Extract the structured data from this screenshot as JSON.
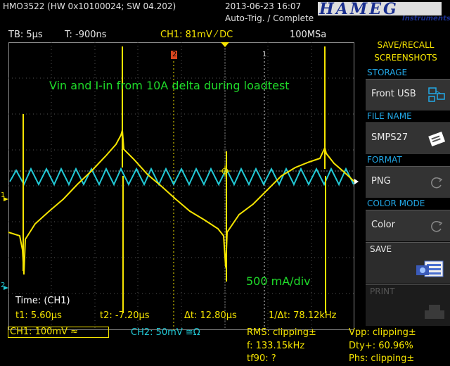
{
  "header": {
    "instrument": "HMO3522 (HW 0x10100024; SW 04.202)",
    "datetime": "2013-06-23 16:07",
    "trigger_status": "Auto-Trig. / Complete",
    "logo": "HAMEG",
    "logo_sub": "Instruments"
  },
  "status_bar": {
    "timebase": "TB: 5µs",
    "trigger_time": "T: -900ns",
    "ch1_trigger": "CH1: 81mV ⁄ DC",
    "sample_rate": "100MSa"
  },
  "screen": {
    "annotation": "Vin and I-in from 10A delta during loadtest",
    "scale_note": "500 mA/div",
    "marker_cursor_1": "1",
    "marker_cursor_2": "2",
    "ch1_marker": "1",
    "ch2_marker": "2"
  },
  "cursors": {
    "title": "Time: (CH1)",
    "t1": "t1: 5.60µs",
    "t2": "t2: -7.20µs",
    "dt": "Δt: 12.80µs",
    "inv_dt": "1/Δt: 78.12kHz"
  },
  "bottom": {
    "ch1": "CH1: 100mV ≈",
    "ch2": "CH2: 50mV ≅Ω",
    "rms": "RMS: clipping±",
    "freq": "f: 133.15kHz",
    "tf90": "tf90: ?",
    "vpp": "Vpp: clipping±",
    "duty": "Dty+: 60.96%",
    "phase": "Phs: clipping±"
  },
  "menu": {
    "title_line1": "SAVE/RECALL",
    "title_line2": "SCREENSHOTS",
    "storage_label": "STORAGE",
    "storage_value": "Front USB",
    "filename_label": "FILE NAME",
    "filename_value": "SMPS27",
    "format_label": "FORMAT",
    "format_value": "PNG",
    "colormode_label": "COLOR MODE",
    "colormode_value": "Color",
    "save_label": "SAVE",
    "print_label": "PRINT"
  },
  "colors": {
    "ch1": "#f5e400",
    "ch2": "#22c9d6",
    "annotation": "#1fdc2a",
    "menu_label": "#22a9e8"
  }
}
